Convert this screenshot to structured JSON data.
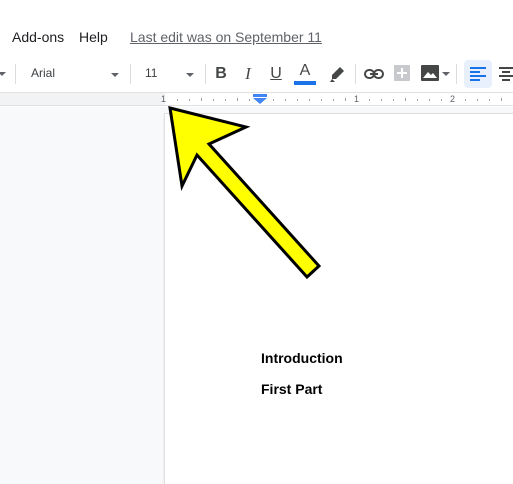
{
  "menu": {
    "addons_label": "Add-ons",
    "help_label": "Help",
    "last_edit": "Last edit was on September 11"
  },
  "toolbar": {
    "font_name": "Arial",
    "font_size": "11",
    "bold_label": "B",
    "italic_label": "I",
    "underline_label": "U",
    "text_color_label": "A",
    "text_color": "#1a73e8",
    "highlight_color": "#444746",
    "icons": [
      "bold-icon",
      "italic-icon",
      "underline-icon",
      "text-color-icon",
      "highlight-icon",
      "link-icon",
      "add-comment-icon",
      "insert-image-icon",
      "align-left-icon",
      "align-center-icon"
    ]
  },
  "ruler": {
    "label_start": "1",
    "label_mid": "1",
    "label_end": "2"
  },
  "document": {
    "lines": [
      "Introduction",
      "First Part"
    ]
  },
  "annotation": {
    "arrow_color": "#ffff00",
    "arrow_outline": "#000000"
  }
}
